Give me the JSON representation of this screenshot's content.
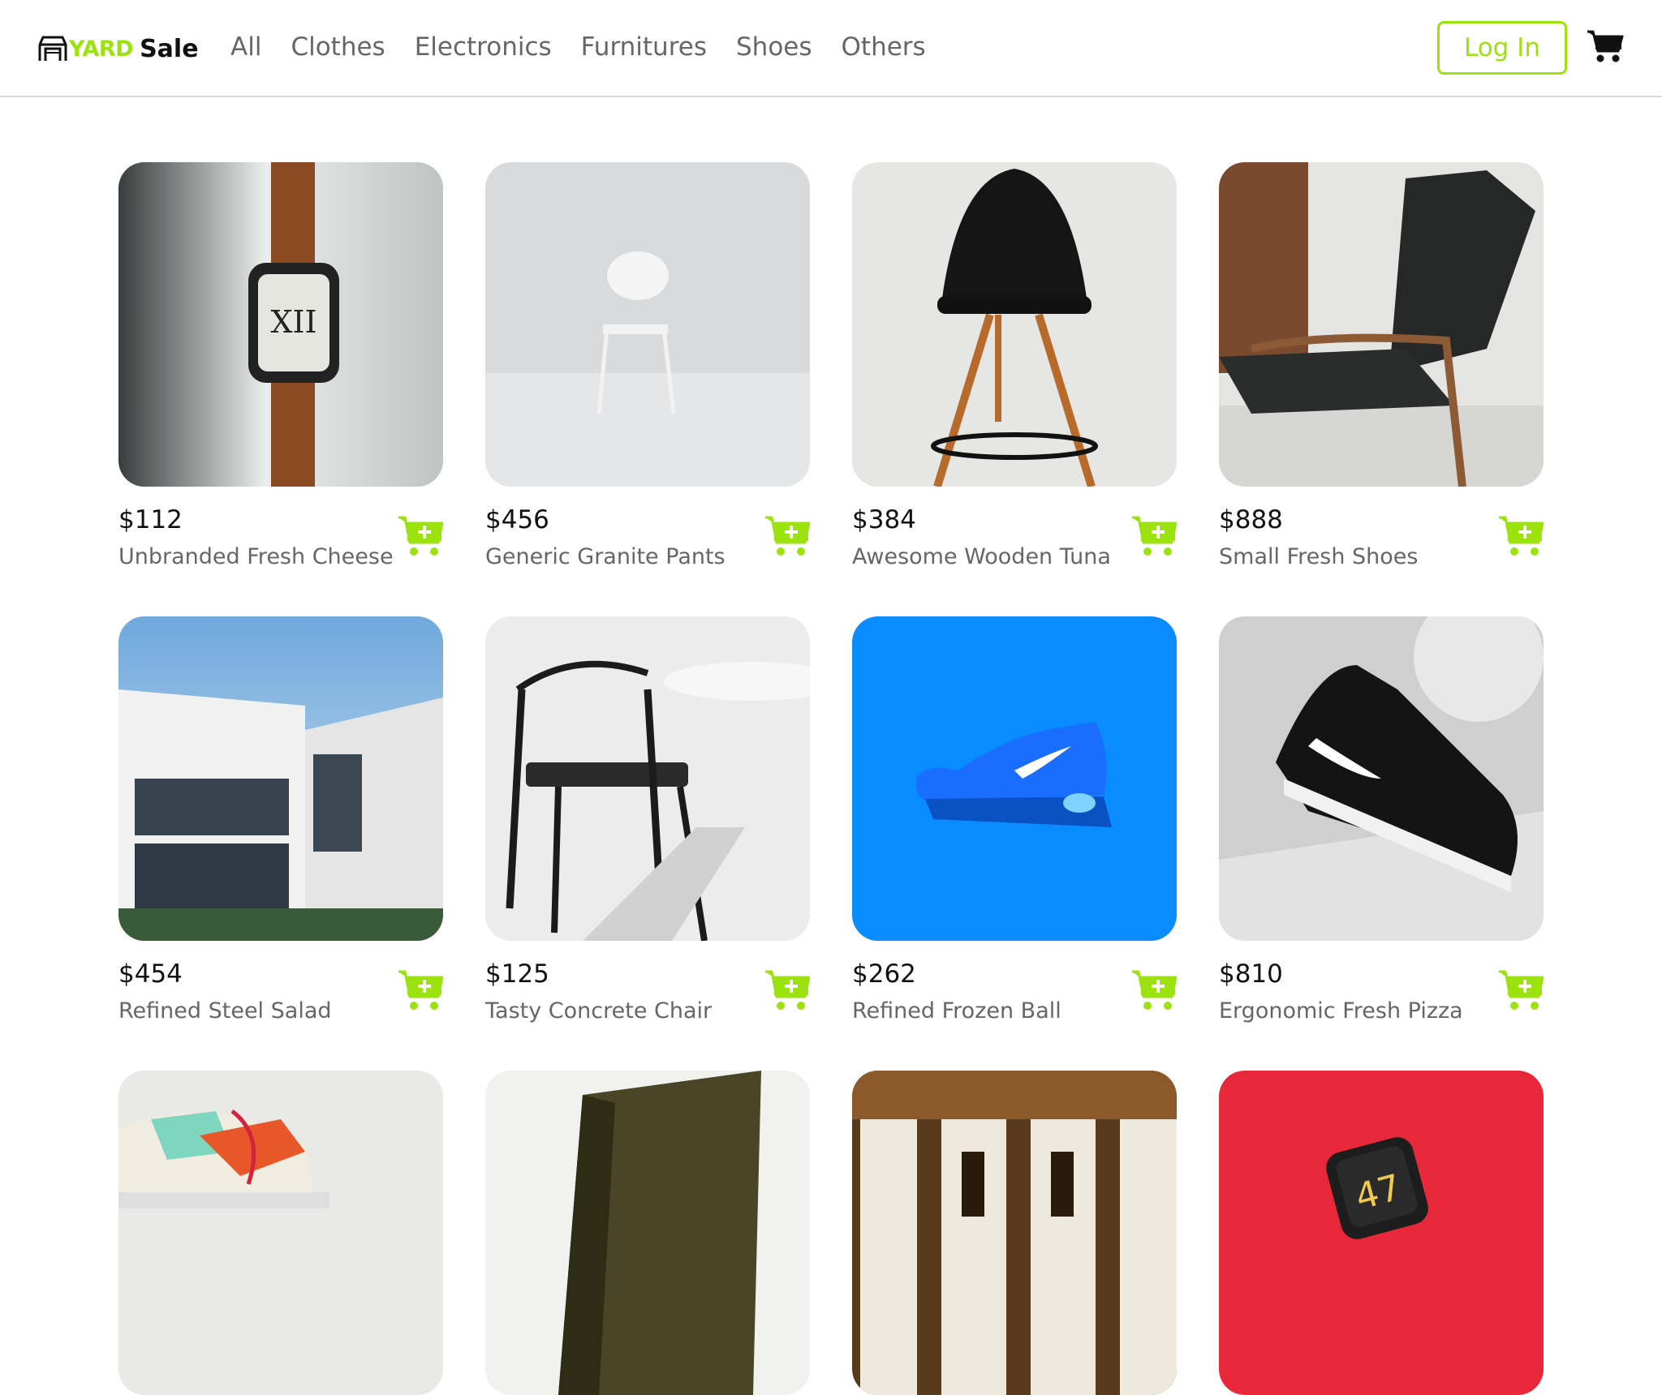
{
  "brand": {
    "accent": "YARD",
    "name": "Sale",
    "accent_color": "#9be20f",
    "icon": "storefront-icon"
  },
  "nav": {
    "links": [
      "All",
      "Clothes",
      "Electronics",
      "Furnitures",
      "Shoes",
      "Others"
    ],
    "login_label": "Log In",
    "cart_icon": "shopping-cart-icon"
  },
  "products": [
    {
      "price": "$112",
      "name": "Unbranded Fresh Cheese",
      "image": "smartwatch-photo"
    },
    {
      "price": "$456",
      "name": "Generic Granite Pants",
      "image": "white-chair-photo"
    },
    {
      "price": "$384",
      "name": "Awesome Wooden Tuna",
      "image": "black-stool-photo"
    },
    {
      "price": "$888",
      "name": "Small Fresh Shoes",
      "image": "armchair-photo"
    },
    {
      "price": "$454",
      "name": "Refined Steel Salad",
      "image": "modern-house-photo"
    },
    {
      "price": "$125",
      "name": "Tasty Concrete Chair",
      "image": "wishbone-chair-photo"
    },
    {
      "price": "$262",
      "name": "Refined Frozen Ball",
      "image": "blue-sneaker-photo"
    },
    {
      "price": "$810",
      "name": "Ergonomic Fresh Pizza",
      "image": "black-sneaker-photo"
    },
    {
      "image": "colorful-sneaker-photo"
    },
    {
      "image": "olive-chair-photo"
    },
    {
      "image": "doom-poster-photo"
    },
    {
      "image": "red-watch-photo"
    }
  ],
  "add_to_cart_icon": "cart-add-icon"
}
